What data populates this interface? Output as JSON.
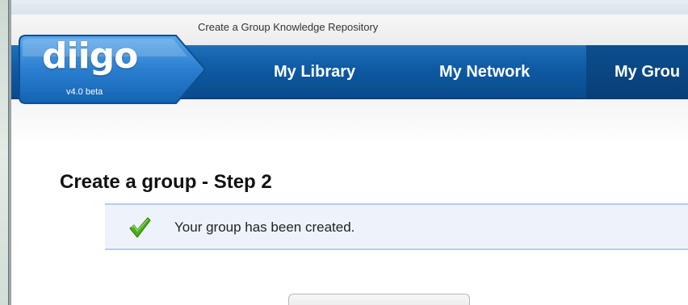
{
  "header": {
    "tagline": "Create a Group Knowledge Repository"
  },
  "logo": {
    "text": "diigo",
    "version": "v4.0 beta"
  },
  "nav": {
    "items": [
      {
        "label": "My Library"
      },
      {
        "label": "My Network"
      },
      {
        "label": "My Grou"
      }
    ]
  },
  "main": {
    "heading": "Create a group - Step 2",
    "alert": {
      "message": "Your group has been created.",
      "icon": "check-icon"
    }
  },
  "colors": {
    "nav_blue": "#0e5aa3",
    "alert_bg": "#eef3fb",
    "alert_border": "#b8cdea",
    "check_green": "#4caf1c"
  }
}
